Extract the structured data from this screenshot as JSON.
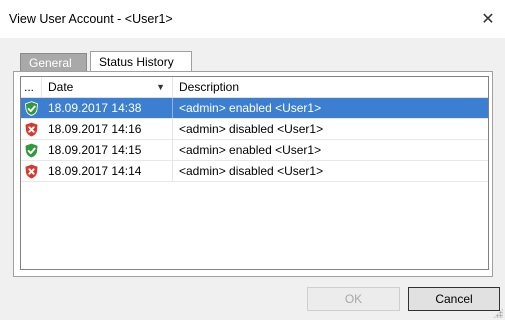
{
  "window": {
    "title": "View User Account - <User1>",
    "close_glyph": "✕"
  },
  "tabs": [
    {
      "label": "General",
      "active": false
    },
    {
      "label": "Status History",
      "active": true
    }
  ],
  "table": {
    "columns": [
      "...",
      "Date",
      "Description"
    ],
    "sort_glyph": "▼",
    "rows": [
      {
        "icon": "shield-check-icon",
        "status": "enabled",
        "date": "18.09.2017 14:38",
        "description": "<admin> enabled <User1>",
        "selected": true
      },
      {
        "icon": "shield-x-icon",
        "status": "disabled",
        "date": "18.09.2017 14:16",
        "description": "<admin> disabled <User1>",
        "selected": false
      },
      {
        "icon": "shield-check-icon",
        "status": "enabled",
        "date": "18.09.2017 14:15",
        "description": "<admin> enabled <User1>",
        "selected": false
      },
      {
        "icon": "shield-x-icon",
        "status": "disabled",
        "date": "18.09.2017 14:14",
        "description": "<admin> disabled <User1>",
        "selected": false
      }
    ]
  },
  "buttons": {
    "ok_label": "OK",
    "cancel_label": "Cancel"
  },
  "colors": {
    "selection": "#3c7fd1",
    "enabled": "#2f9a3a",
    "disabled": "#d63a2f"
  }
}
